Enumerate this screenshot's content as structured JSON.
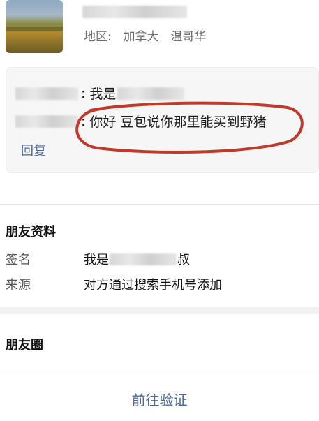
{
  "header": {
    "region_label": "地区:",
    "region_country": "加拿大",
    "region_city": "温哥华"
  },
  "greeting": {
    "message_1_text": "我是",
    "message_2_text": "你好 豆包说你那里能买到野猪",
    "reply_label": "回复",
    "highlight_color": "#c0392b"
  },
  "profile": {
    "section_title": "朋友资料",
    "signature_label": "签名",
    "signature_prefix": "我是",
    "signature_suffix": "叔",
    "source_label": "来源",
    "source_value": "对方通过搜索手机号添加"
  },
  "moments": {
    "section_title": "朋友圈"
  },
  "actions": {
    "verify_label": "前往验证"
  },
  "colors": {
    "link": "#4a6a98",
    "secondary_text": "#6b6b6b"
  }
}
